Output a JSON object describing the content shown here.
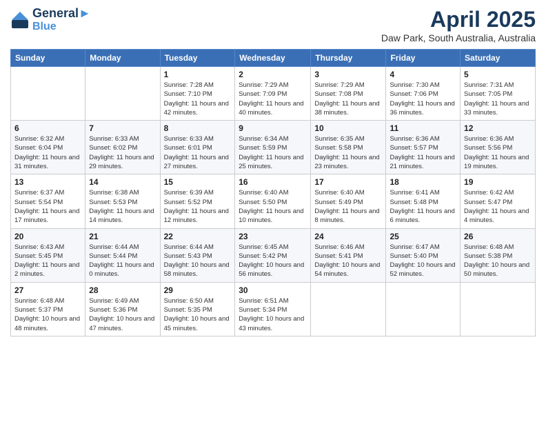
{
  "header": {
    "logo_line1": "General",
    "logo_line2": "Blue",
    "month": "April 2025",
    "location": "Daw Park, South Australia, Australia"
  },
  "weekdays": [
    "Sunday",
    "Monday",
    "Tuesday",
    "Wednesday",
    "Thursday",
    "Friday",
    "Saturday"
  ],
  "weeks": [
    [
      {
        "day": "",
        "info": ""
      },
      {
        "day": "",
        "info": ""
      },
      {
        "day": "1",
        "info": "Sunrise: 7:28 AM\nSunset: 7:10 PM\nDaylight: 11 hours and 42 minutes."
      },
      {
        "day": "2",
        "info": "Sunrise: 7:29 AM\nSunset: 7:09 PM\nDaylight: 11 hours and 40 minutes."
      },
      {
        "day": "3",
        "info": "Sunrise: 7:29 AM\nSunset: 7:08 PM\nDaylight: 11 hours and 38 minutes."
      },
      {
        "day": "4",
        "info": "Sunrise: 7:30 AM\nSunset: 7:06 PM\nDaylight: 11 hours and 36 minutes."
      },
      {
        "day": "5",
        "info": "Sunrise: 7:31 AM\nSunset: 7:05 PM\nDaylight: 11 hours and 33 minutes."
      }
    ],
    [
      {
        "day": "6",
        "info": "Sunrise: 6:32 AM\nSunset: 6:04 PM\nDaylight: 11 hours and 31 minutes."
      },
      {
        "day": "7",
        "info": "Sunrise: 6:33 AM\nSunset: 6:02 PM\nDaylight: 11 hours and 29 minutes."
      },
      {
        "day": "8",
        "info": "Sunrise: 6:33 AM\nSunset: 6:01 PM\nDaylight: 11 hours and 27 minutes."
      },
      {
        "day": "9",
        "info": "Sunrise: 6:34 AM\nSunset: 5:59 PM\nDaylight: 11 hours and 25 minutes."
      },
      {
        "day": "10",
        "info": "Sunrise: 6:35 AM\nSunset: 5:58 PM\nDaylight: 11 hours and 23 minutes."
      },
      {
        "day": "11",
        "info": "Sunrise: 6:36 AM\nSunset: 5:57 PM\nDaylight: 11 hours and 21 minutes."
      },
      {
        "day": "12",
        "info": "Sunrise: 6:36 AM\nSunset: 5:56 PM\nDaylight: 11 hours and 19 minutes."
      }
    ],
    [
      {
        "day": "13",
        "info": "Sunrise: 6:37 AM\nSunset: 5:54 PM\nDaylight: 11 hours and 17 minutes."
      },
      {
        "day": "14",
        "info": "Sunrise: 6:38 AM\nSunset: 5:53 PM\nDaylight: 11 hours and 14 minutes."
      },
      {
        "day": "15",
        "info": "Sunrise: 6:39 AM\nSunset: 5:52 PM\nDaylight: 11 hours and 12 minutes."
      },
      {
        "day": "16",
        "info": "Sunrise: 6:40 AM\nSunset: 5:50 PM\nDaylight: 11 hours and 10 minutes."
      },
      {
        "day": "17",
        "info": "Sunrise: 6:40 AM\nSunset: 5:49 PM\nDaylight: 11 hours and 8 minutes."
      },
      {
        "day": "18",
        "info": "Sunrise: 6:41 AM\nSunset: 5:48 PM\nDaylight: 11 hours and 6 minutes."
      },
      {
        "day": "19",
        "info": "Sunrise: 6:42 AM\nSunset: 5:47 PM\nDaylight: 11 hours and 4 minutes."
      }
    ],
    [
      {
        "day": "20",
        "info": "Sunrise: 6:43 AM\nSunset: 5:45 PM\nDaylight: 11 hours and 2 minutes."
      },
      {
        "day": "21",
        "info": "Sunrise: 6:44 AM\nSunset: 5:44 PM\nDaylight: 11 hours and 0 minutes."
      },
      {
        "day": "22",
        "info": "Sunrise: 6:44 AM\nSunset: 5:43 PM\nDaylight: 10 hours and 58 minutes."
      },
      {
        "day": "23",
        "info": "Sunrise: 6:45 AM\nSunset: 5:42 PM\nDaylight: 10 hours and 56 minutes."
      },
      {
        "day": "24",
        "info": "Sunrise: 6:46 AM\nSunset: 5:41 PM\nDaylight: 10 hours and 54 minutes."
      },
      {
        "day": "25",
        "info": "Sunrise: 6:47 AM\nSunset: 5:40 PM\nDaylight: 10 hours and 52 minutes."
      },
      {
        "day": "26",
        "info": "Sunrise: 6:48 AM\nSunset: 5:38 PM\nDaylight: 10 hours and 50 minutes."
      }
    ],
    [
      {
        "day": "27",
        "info": "Sunrise: 6:48 AM\nSunset: 5:37 PM\nDaylight: 10 hours and 48 minutes."
      },
      {
        "day": "28",
        "info": "Sunrise: 6:49 AM\nSunset: 5:36 PM\nDaylight: 10 hours and 47 minutes."
      },
      {
        "day": "29",
        "info": "Sunrise: 6:50 AM\nSunset: 5:35 PM\nDaylight: 10 hours and 45 minutes."
      },
      {
        "day": "30",
        "info": "Sunrise: 6:51 AM\nSunset: 5:34 PM\nDaylight: 10 hours and 43 minutes."
      },
      {
        "day": "",
        "info": ""
      },
      {
        "day": "",
        "info": ""
      },
      {
        "day": "",
        "info": ""
      }
    ]
  ]
}
